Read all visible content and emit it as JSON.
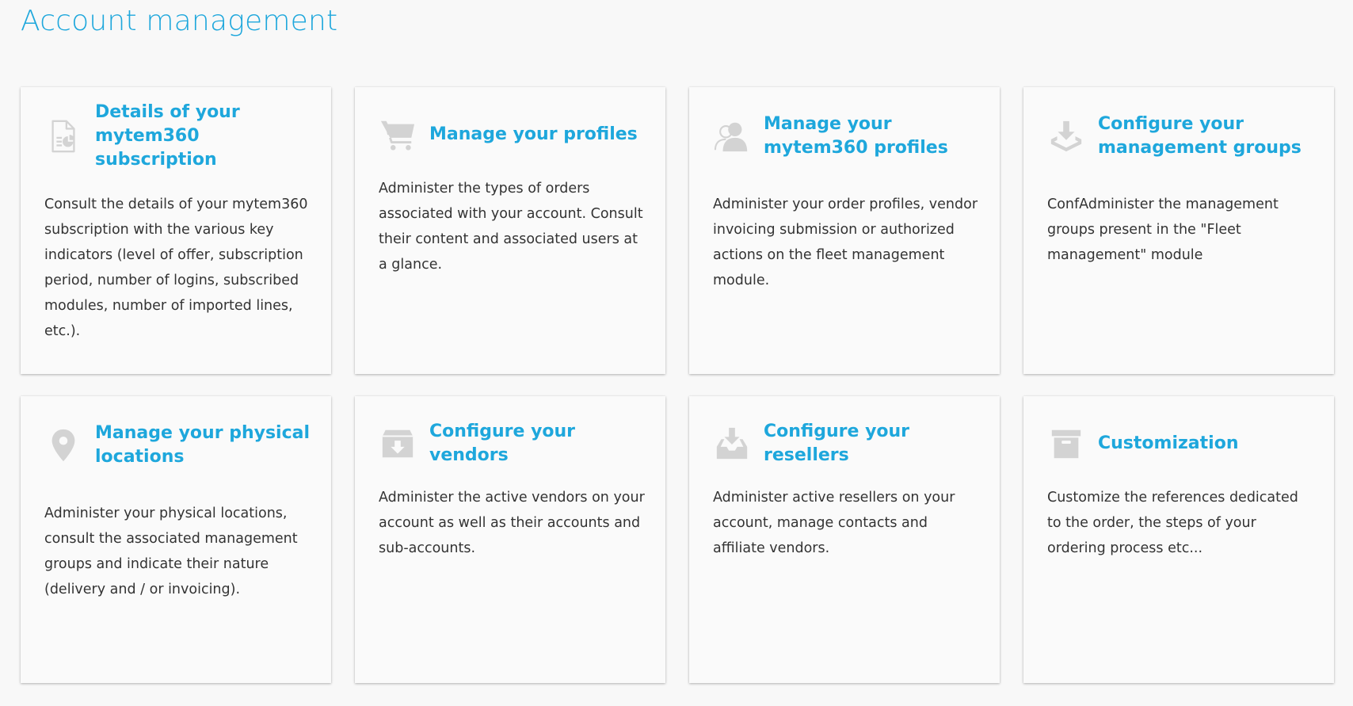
{
  "page": {
    "title": "Account management"
  },
  "colors": {
    "accent": "#1ea7dc",
    "icon": "#d3d3d3",
    "text": "#333333",
    "background": "#f8f8f8",
    "card": "#fafafa"
  },
  "cards": [
    {
      "icon": "document-chart-icon",
      "title": "Details of your mytem360 subscription",
      "description": "Consult the details of your mytem360 subscription with the various key indicators (level of offer, subscription period, number of logins, subscribed modules, number of imported lines, etc.)."
    },
    {
      "icon": "shopping-cart-icon",
      "title": "Manage your profiles",
      "description": "Administer the types of orders associated with your account. Consult their content and associated users at a glance."
    },
    {
      "icon": "users-icon",
      "title": "Manage your mytem360 profiles",
      "description": "Administer your order profiles, vendor invoicing submission or authorized actions on the fleet management module."
    },
    {
      "icon": "download-tray-icon",
      "title": "Configure your management groups",
      "description": "ConfAdminister the management groups present in the \"Fleet management\" module"
    },
    {
      "icon": "map-pin-icon",
      "title": "Manage your physical locations",
      "description": "Administer your physical locations, consult the associated management groups and indicate their nature (delivery and / or invoicing)."
    },
    {
      "icon": "inbox-download-icon",
      "title": "Configure your vendors",
      "description": "Administer the active vendors on your account as well as their accounts and sub-accounts."
    },
    {
      "icon": "inbox-tray-icon",
      "title": "Configure your resellers",
      "description": "Administer active resellers on your account, manage contacts and affiliate vendors."
    },
    {
      "icon": "archive-box-icon",
      "title": "Customization",
      "description": "Customize the references dedicated to the order, the steps of your ordering process etc..."
    }
  ]
}
